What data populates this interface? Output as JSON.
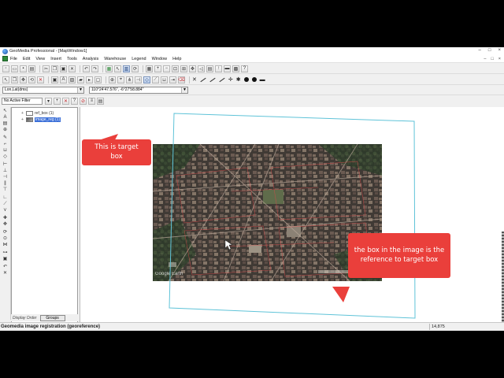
{
  "window": {
    "title": "GeoMedia Professional - [MapWindow1]",
    "controls": [
      "–",
      "□",
      "×"
    ]
  },
  "menubar": {
    "items": [
      "File",
      "Edit",
      "View",
      "Insert",
      "Tools",
      "Analysis",
      "Warehouse",
      "Legend",
      "Window",
      "Help"
    ],
    "doc_controls": [
      "–",
      "□",
      "×"
    ]
  },
  "coordbar": {
    "coord_system": "Lon,Lat(dms)",
    "coordinate_readout": "110°24'47.576\", -6°27'58.884\""
  },
  "filterbar": {
    "filter_text": "No Active Filter"
  },
  "legend": {
    "entries": [
      {
        "label": "ref_box (1)",
        "selected": false
      },
      {
        "label": "image_reg (1)",
        "selected": true
      }
    ],
    "footer_label": "Display Order",
    "groups_button": "Groups"
  },
  "map": {
    "watermark": "Google Earth",
    "north_arrow": "⬆"
  },
  "callouts": {
    "target": "This is target box",
    "reference": "the box in the image is the reference to target box"
  },
  "statusbar": {
    "text": "Geomedia image registration (georeference)",
    "scale": "14,875"
  },
  "colors": {
    "callout_red": "#ea3f3b",
    "target_box_line": "#5fc3d8",
    "selection_blue": "#3b6fd8",
    "reference_box_line": "#c23a3a"
  }
}
